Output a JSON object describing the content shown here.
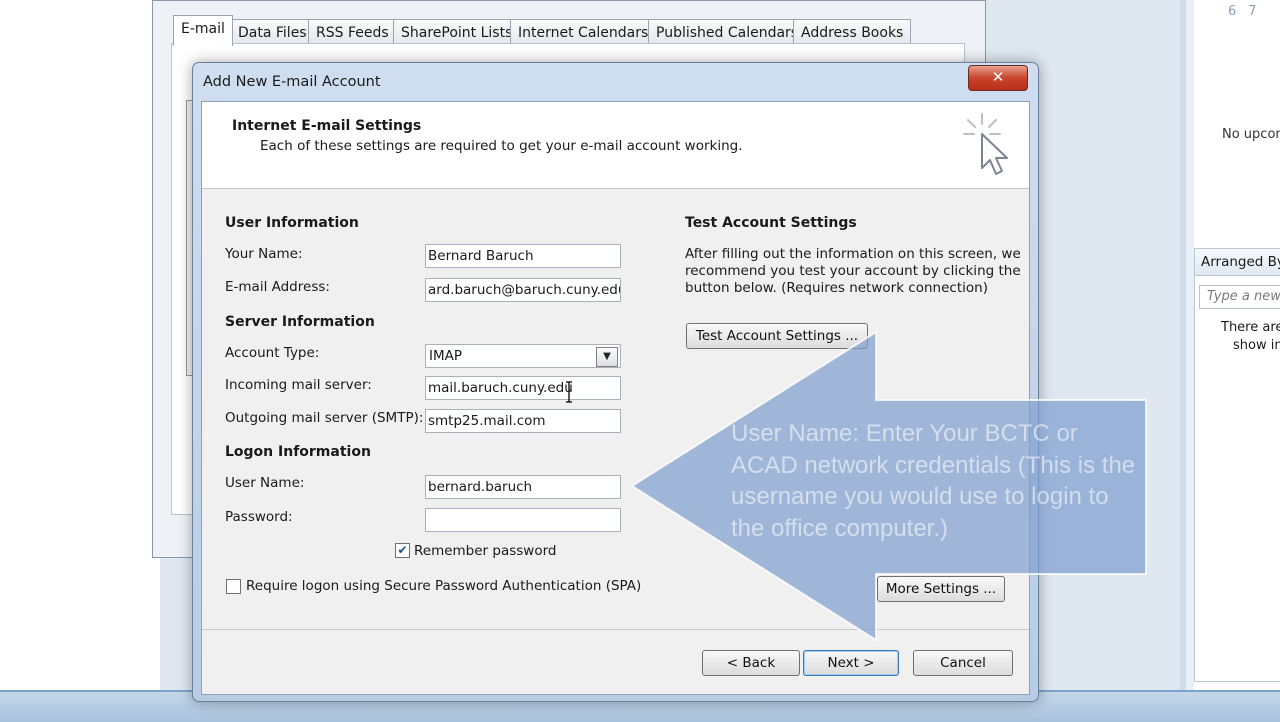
{
  "background": {
    "calendar_days": [
      "6",
      "7"
    ],
    "no_upcoming": "No upcomi",
    "arranged_by": "Arranged By",
    "type_new_placeholder": "Type a new",
    "empty_line1": "There are",
    "empty_line2": "show in"
  },
  "account_settings": {
    "tabs": [
      "E-mail",
      "Data Files",
      "RSS Feeds",
      "SharePoint Lists",
      "Internet Calendars",
      "Published Calendars",
      "Address Books"
    ]
  },
  "dialog": {
    "title": "Add New E-mail Account",
    "close_label": "✕",
    "header_title": "Internet E-mail Settings",
    "header_subtitle": "Each of these settings are required to get your e-mail account working.",
    "user_info": {
      "heading": "User Information",
      "name_label": "Your Name:",
      "name_value": "Bernard Baruch",
      "email_label": "E-mail Address:",
      "email_value": "ard.baruch@baruch.cuny.edu"
    },
    "server_info": {
      "heading": "Server Information",
      "account_type_label": "Account Type:",
      "account_type_value": "IMAP",
      "incoming_label": "Incoming mail server:",
      "incoming_value": "mail.baruch.cuny.edu",
      "outgoing_label": "Outgoing mail server (SMTP):",
      "outgoing_value": "smtp25.mail.com"
    },
    "logon_info": {
      "heading": "Logon Information",
      "username_label": "User Name:",
      "username_value": "bernard.baruch",
      "password_label": "Password:",
      "password_value": "",
      "remember_label": "Remember password",
      "remember_checked": true,
      "spa_label": "Require logon using Secure Password Authentication (SPA)",
      "spa_checked": false
    },
    "test_settings": {
      "heading": "Test Account Settings",
      "description": [
        "After filling out the information on this screen, we",
        "recommend you test your account by clicking the",
        "button below. (Requires network connection)"
      ],
      "button_label": "Test Account Settings ..."
    },
    "more_settings_label": "More Settings ...",
    "back_label": "< Back",
    "next_label": "Next >",
    "cancel_label": "Cancel"
  },
  "callout": {
    "text": "User Name: Enter Your BCTC or ACAD network credentials (This is the username you would use to login to the office computer.)"
  },
  "colors": {
    "callout_fill": "#7f9fcf",
    "dialog_frame": "#b7cce4",
    "close_button": "#c8442a"
  }
}
